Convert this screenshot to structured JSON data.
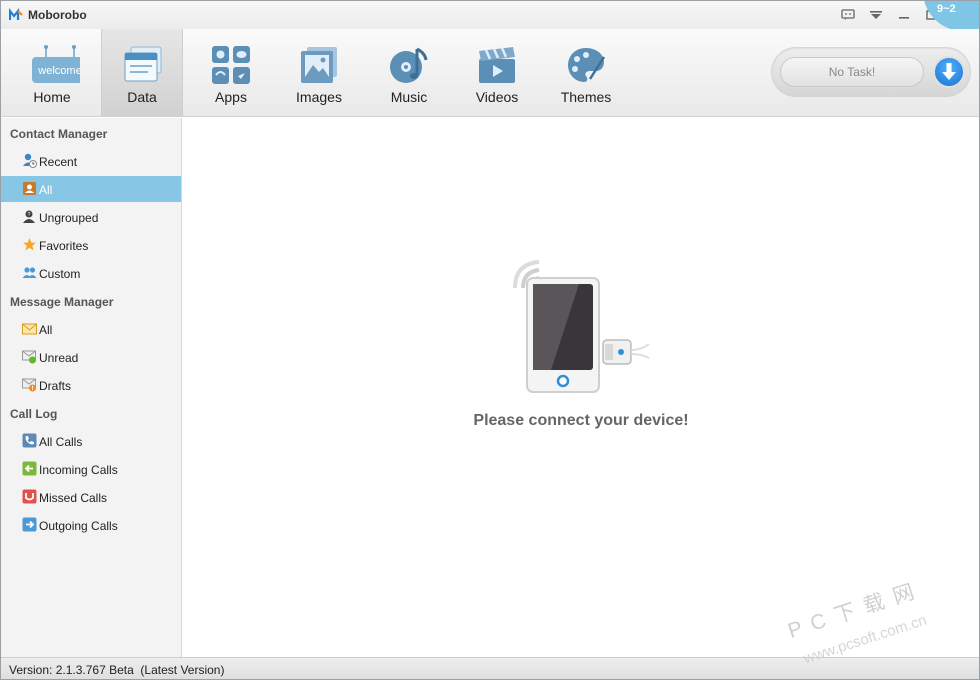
{
  "window": {
    "title": "Moborobo",
    "corner_badge": "9~2"
  },
  "toolbar": {
    "items": [
      {
        "label": "Home",
        "icon": "welcome-icon",
        "icon_text": "welcome"
      },
      {
        "label": "Data",
        "icon": "data-icon",
        "active": true
      },
      {
        "label": "Apps",
        "icon": "apps-icon"
      },
      {
        "label": "Images",
        "icon": "images-icon"
      },
      {
        "label": "Music",
        "icon": "music-icon"
      },
      {
        "label": "Videos",
        "icon": "videos-icon"
      },
      {
        "label": "Themes",
        "icon": "themes-icon"
      }
    ],
    "task_status": "No Task!",
    "download_icon": "download-arrow-icon"
  },
  "sidebar": {
    "sections": [
      {
        "title": "Contact Manager",
        "items": [
          {
            "label": "Recent",
            "icon": "recent-contact-icon"
          },
          {
            "label": "All",
            "icon": "all-contacts-icon",
            "selected": true
          },
          {
            "label": "Ungrouped",
            "icon": "ungrouped-icon"
          },
          {
            "label": "Favorites",
            "icon": "star-icon"
          },
          {
            "label": "Custom",
            "icon": "custom-group-icon"
          }
        ]
      },
      {
        "title": "Message Manager",
        "items": [
          {
            "label": "All",
            "icon": "envelope-icon"
          },
          {
            "label": "Unread",
            "icon": "unread-message-icon"
          },
          {
            "label": "Drafts",
            "icon": "draft-message-icon"
          }
        ]
      },
      {
        "title": "Call Log",
        "items": [
          {
            "label": "All Calls",
            "icon": "phone-icon"
          },
          {
            "label": "Incoming Calls",
            "icon": "incoming-call-icon"
          },
          {
            "label": "Missed Calls",
            "icon": "missed-call-icon"
          },
          {
            "label": "Outgoing Calls",
            "icon": "outgoing-call-icon"
          }
        ]
      }
    ]
  },
  "main": {
    "message": "Please connect your device!"
  },
  "status": {
    "version": "Version: 2.1.3.767 Beta  (Latest Version)"
  },
  "watermark": {
    "line1": "P C 下 载 网",
    "line2": "www.pcsoft.com.cn"
  },
  "colors": {
    "selected_row": "#88c6e6",
    "accent_blue": "#1a72cf",
    "corner_badge": "#7fc6e6"
  }
}
